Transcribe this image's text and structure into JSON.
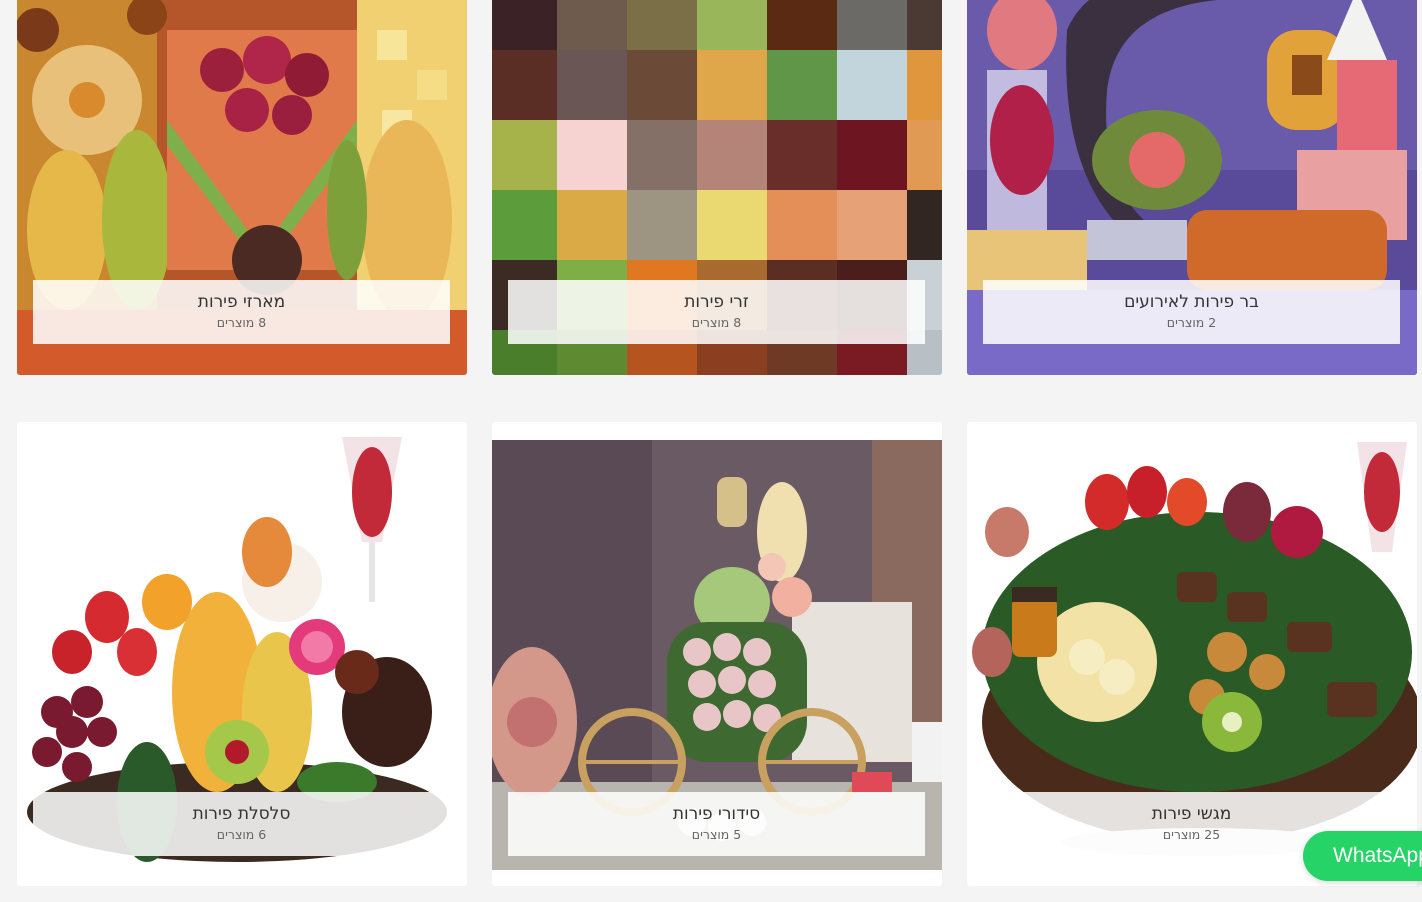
{
  "categories": [
    {
      "title": "מארזי פירות",
      "count": "8 מוצרים",
      "image": "fruit-platter-photo"
    },
    {
      "title": "זרי פירות",
      "count": "8 מוצרים",
      "image": "pixelated-fruit-bouquet-photo"
    },
    {
      "title": "בר פירות לאירועים",
      "count": "2 מוצרים",
      "image": "event-fruit-bar-photo"
    },
    {
      "title": "סלסלת פירות",
      "count": "6 מוצרים",
      "image": "fruit-basket-photo"
    },
    {
      "title": "סידורי פירות",
      "count": "5 מוצרים",
      "image": "carved-watermelon-carriage-photo"
    },
    {
      "title": "מגשי פירות",
      "count": "25 מוצרים",
      "image": "fruit-tray-photo"
    }
  ],
  "whatsapp": {
    "label": "WhatsApp",
    "icon": "whatsapp-icon"
  }
}
